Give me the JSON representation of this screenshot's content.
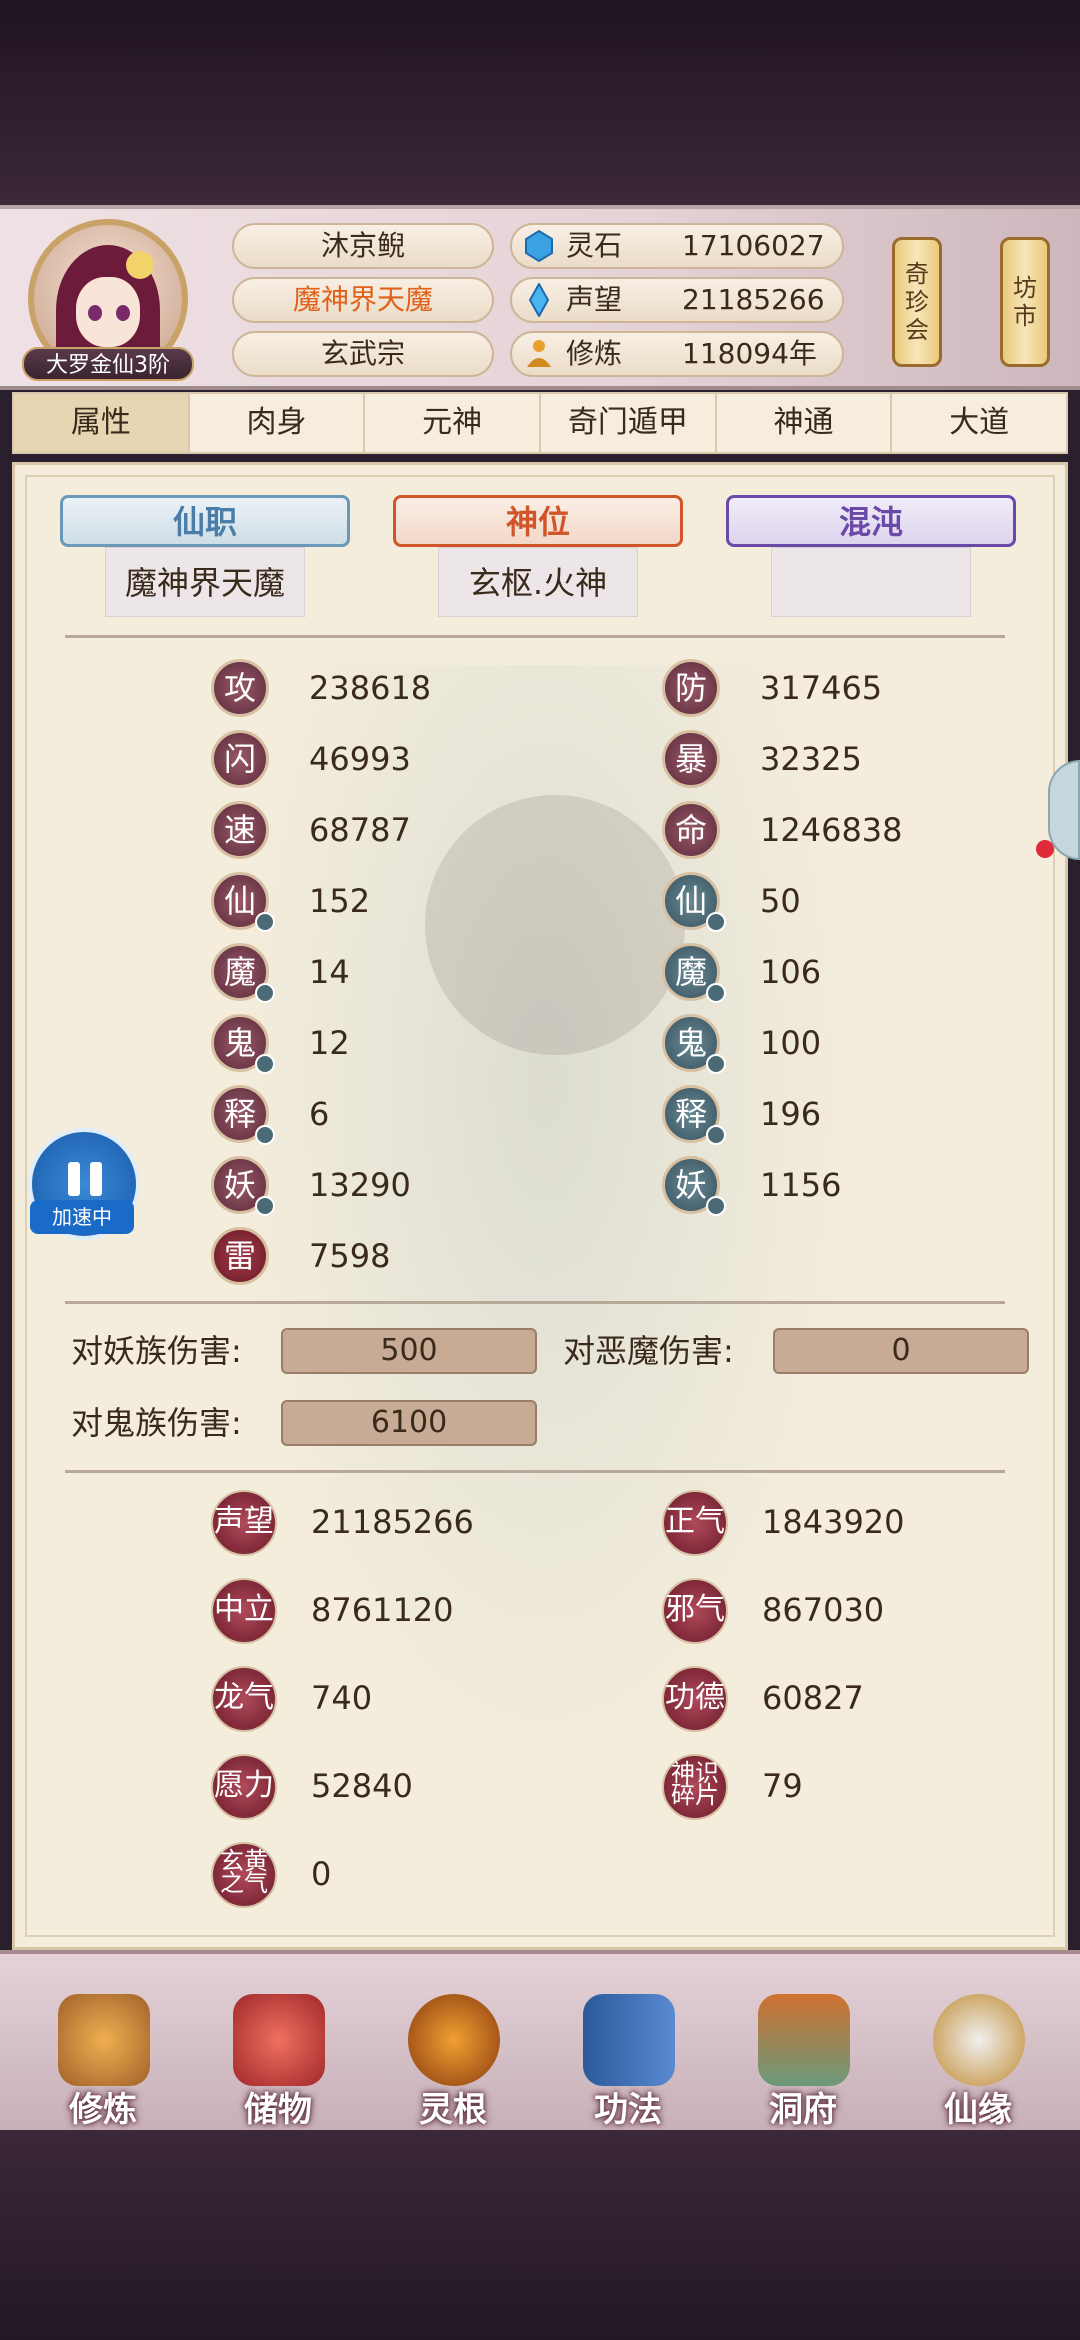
{
  "header": {
    "rank": "大罗金仙3阶",
    "names": [
      "沐京鲵",
      "魔神界天魔",
      "玄武宗"
    ],
    "resources": [
      {
        "icon": "spirit-stone-icon",
        "label": "灵石",
        "value": "17106027"
      },
      {
        "icon": "reputation-crystal-icon",
        "label": "声望",
        "value": "21185266"
      },
      {
        "icon": "cultivation-icon",
        "label": "修炼",
        "value": "118094年"
      }
    ],
    "shop_buttons": [
      "奇珍会",
      "坊市"
    ]
  },
  "tabs": [
    "属性",
    "肉身",
    "元神",
    "奇门遁甲",
    "神通",
    "大道"
  ],
  "titles": [
    {
      "header": "仙职",
      "value": "魔神界天魔",
      "color": "#4a7ea8"
    },
    {
      "header": "神位",
      "value": "玄枢.火神",
      "color": "#d2552a"
    },
    {
      "header": "混沌",
      "value": "",
      "color": "#6a4aa8"
    }
  ],
  "stats_left": [
    {
      "badge": "攻",
      "value": "238618",
      "style": "plain"
    },
    {
      "badge": "闪",
      "value": "46993",
      "style": "plain"
    },
    {
      "badge": "速",
      "value": "68787",
      "style": "plain"
    },
    {
      "badge": "仙",
      "value": "152",
      "style": "mark"
    },
    {
      "badge": "魔",
      "value": "14",
      "style": "mark"
    },
    {
      "badge": "鬼",
      "value": "12",
      "style": "mark"
    },
    {
      "badge": "释",
      "value": "6",
      "style": "mark"
    },
    {
      "badge": "妖",
      "value": "13290",
      "style": "mark"
    },
    {
      "badge": "雷",
      "value": "7598",
      "style": "red"
    }
  ],
  "stats_right": [
    {
      "badge": "防",
      "value": "317465"
    },
    {
      "badge": "暴",
      "value": "32325"
    },
    {
      "badge": "命",
      "value": "1246838"
    },
    {
      "badge": "仙",
      "value": "50"
    },
    {
      "badge": "魔",
      "value": "106"
    },
    {
      "badge": "鬼",
      "value": "100"
    },
    {
      "badge": "释",
      "value": "196"
    },
    {
      "badge": "妖",
      "value": "1156"
    }
  ],
  "damage": [
    {
      "label": "对妖族伤害:",
      "value": "500"
    },
    {
      "label": "对恶魔伤害:",
      "value": "0"
    },
    {
      "label": "对鬼族伤害:",
      "value": "6100"
    }
  ],
  "reputation_left": [
    {
      "badge": "声望",
      "value": "21185266"
    },
    {
      "badge": "中立",
      "value": "8761120"
    },
    {
      "badge": "龙气",
      "value": "740"
    },
    {
      "badge": "愿力",
      "value": "52840"
    },
    {
      "badge": "玄黄之气",
      "value": "0"
    }
  ],
  "reputation_right": [
    {
      "badge": "正气",
      "value": "1843920"
    },
    {
      "badge": "邪气",
      "value": "867030"
    },
    {
      "badge": "功德",
      "value": "60827"
    },
    {
      "badge": "神识碎片",
      "value": "79"
    }
  ],
  "speed_label": "加速中",
  "bottom_nav": [
    "修炼",
    "储物",
    "灵根",
    "功法",
    "洞府",
    "仙缘"
  ]
}
